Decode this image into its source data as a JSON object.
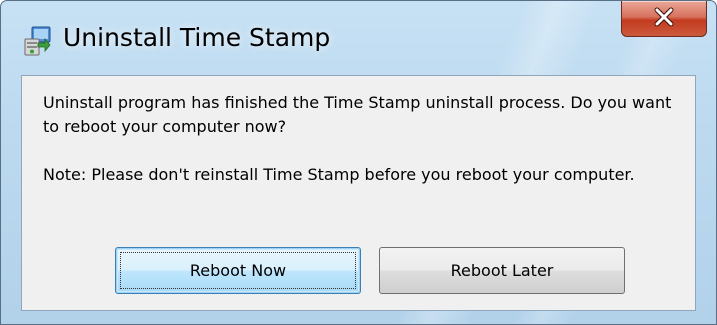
{
  "window": {
    "title": "Uninstall Time Stamp"
  },
  "message": {
    "main": "Uninstall program has finished the Time Stamp uninstall process. Do you want to reboot your computer now?",
    "note": "Note: Please don't reinstall Time Stamp before you reboot your computer."
  },
  "buttons": {
    "reboot_now": "Reboot Now",
    "reboot_later": "Reboot Later"
  },
  "icons": {
    "app": "installer-icon",
    "close": "close-icon"
  },
  "colors": {
    "close_button": "#c8452a",
    "frame": "#bcd9ef",
    "content_bg": "#f0f0f0"
  }
}
